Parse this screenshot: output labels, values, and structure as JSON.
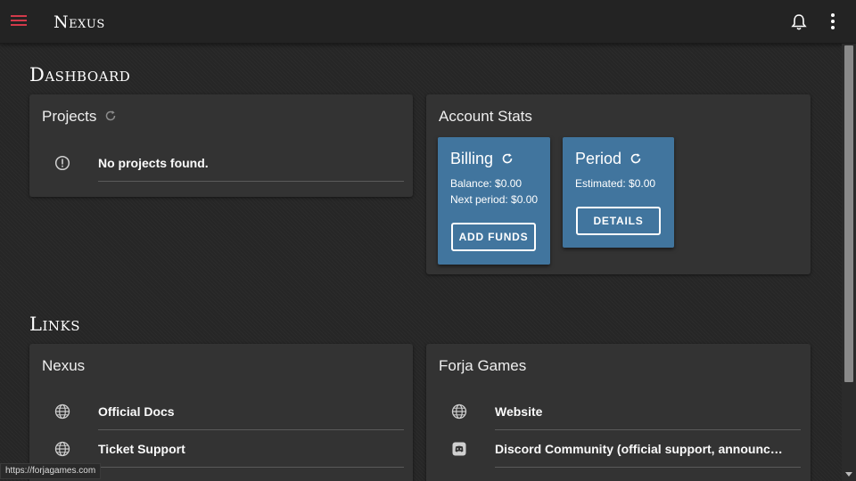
{
  "header": {
    "app_title": "Nexus",
    "menu_icon": "hamburger-menu-icon",
    "notifications_icon": "bell-icon",
    "more_icon": "more-vert-icon"
  },
  "colors": {
    "accent": "#d23a4a",
    "stat_card": "#41759e",
    "card_bg": "#333333"
  },
  "dashboard": {
    "title": "Dashboard",
    "projects": {
      "title": "Projects",
      "empty_message": "No projects found.",
      "empty_icon": "alert-circle-icon"
    },
    "account_stats": {
      "title": "Account Stats",
      "billing": {
        "title": "Billing",
        "balance": "Balance: $0.00",
        "next_period": "Next period: $0.00",
        "button": "ADD FUNDS"
      },
      "period": {
        "title": "Period",
        "estimated": "Estimated: $0.00",
        "button": "DETAILS"
      }
    }
  },
  "links": {
    "title": "Links",
    "nexus": {
      "title": "Nexus",
      "items": [
        {
          "label": "Official Docs",
          "icon": "globe-icon"
        },
        {
          "label": "Ticket Support",
          "icon": "globe-icon"
        }
      ]
    },
    "forja": {
      "title": "Forja Games",
      "items": [
        {
          "label": "Website",
          "icon": "globe-icon"
        },
        {
          "label": "Discord Community (official support, announcements, and more)",
          "icon": "discord-icon"
        }
      ]
    }
  },
  "status_bar": {
    "url": "https://forjagames.com"
  }
}
